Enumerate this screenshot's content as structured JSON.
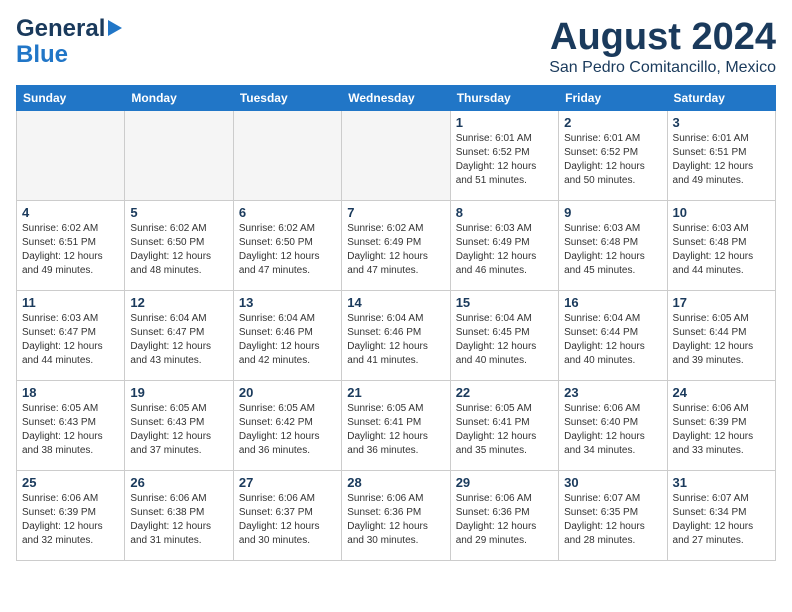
{
  "header": {
    "logo_line1": "General",
    "logo_line2": "Blue",
    "month": "August 2024",
    "location": "San Pedro Comitancillo, Mexico"
  },
  "days_of_week": [
    "Sunday",
    "Monday",
    "Tuesday",
    "Wednesday",
    "Thursday",
    "Friday",
    "Saturday"
  ],
  "weeks": [
    [
      {
        "day": "",
        "info": ""
      },
      {
        "day": "",
        "info": ""
      },
      {
        "day": "",
        "info": ""
      },
      {
        "day": "",
        "info": ""
      },
      {
        "day": "1",
        "info": "Sunrise: 6:01 AM\nSunset: 6:52 PM\nDaylight: 12 hours\nand 51 minutes."
      },
      {
        "day": "2",
        "info": "Sunrise: 6:01 AM\nSunset: 6:52 PM\nDaylight: 12 hours\nand 50 minutes."
      },
      {
        "day": "3",
        "info": "Sunrise: 6:01 AM\nSunset: 6:51 PM\nDaylight: 12 hours\nand 49 minutes."
      }
    ],
    [
      {
        "day": "4",
        "info": "Sunrise: 6:02 AM\nSunset: 6:51 PM\nDaylight: 12 hours\nand 49 minutes."
      },
      {
        "day": "5",
        "info": "Sunrise: 6:02 AM\nSunset: 6:50 PM\nDaylight: 12 hours\nand 48 minutes."
      },
      {
        "day": "6",
        "info": "Sunrise: 6:02 AM\nSunset: 6:50 PM\nDaylight: 12 hours\nand 47 minutes."
      },
      {
        "day": "7",
        "info": "Sunrise: 6:02 AM\nSunset: 6:49 PM\nDaylight: 12 hours\nand 47 minutes."
      },
      {
        "day": "8",
        "info": "Sunrise: 6:03 AM\nSunset: 6:49 PM\nDaylight: 12 hours\nand 46 minutes."
      },
      {
        "day": "9",
        "info": "Sunrise: 6:03 AM\nSunset: 6:48 PM\nDaylight: 12 hours\nand 45 minutes."
      },
      {
        "day": "10",
        "info": "Sunrise: 6:03 AM\nSunset: 6:48 PM\nDaylight: 12 hours\nand 44 minutes."
      }
    ],
    [
      {
        "day": "11",
        "info": "Sunrise: 6:03 AM\nSunset: 6:47 PM\nDaylight: 12 hours\nand 44 minutes."
      },
      {
        "day": "12",
        "info": "Sunrise: 6:04 AM\nSunset: 6:47 PM\nDaylight: 12 hours\nand 43 minutes."
      },
      {
        "day": "13",
        "info": "Sunrise: 6:04 AM\nSunset: 6:46 PM\nDaylight: 12 hours\nand 42 minutes."
      },
      {
        "day": "14",
        "info": "Sunrise: 6:04 AM\nSunset: 6:46 PM\nDaylight: 12 hours\nand 41 minutes."
      },
      {
        "day": "15",
        "info": "Sunrise: 6:04 AM\nSunset: 6:45 PM\nDaylight: 12 hours\nand 40 minutes."
      },
      {
        "day": "16",
        "info": "Sunrise: 6:04 AM\nSunset: 6:44 PM\nDaylight: 12 hours\nand 40 minutes."
      },
      {
        "day": "17",
        "info": "Sunrise: 6:05 AM\nSunset: 6:44 PM\nDaylight: 12 hours\nand 39 minutes."
      }
    ],
    [
      {
        "day": "18",
        "info": "Sunrise: 6:05 AM\nSunset: 6:43 PM\nDaylight: 12 hours\nand 38 minutes."
      },
      {
        "day": "19",
        "info": "Sunrise: 6:05 AM\nSunset: 6:43 PM\nDaylight: 12 hours\nand 37 minutes."
      },
      {
        "day": "20",
        "info": "Sunrise: 6:05 AM\nSunset: 6:42 PM\nDaylight: 12 hours\nand 36 minutes."
      },
      {
        "day": "21",
        "info": "Sunrise: 6:05 AM\nSunset: 6:41 PM\nDaylight: 12 hours\nand 36 minutes."
      },
      {
        "day": "22",
        "info": "Sunrise: 6:05 AM\nSunset: 6:41 PM\nDaylight: 12 hours\nand 35 minutes."
      },
      {
        "day": "23",
        "info": "Sunrise: 6:06 AM\nSunset: 6:40 PM\nDaylight: 12 hours\nand 34 minutes."
      },
      {
        "day": "24",
        "info": "Sunrise: 6:06 AM\nSunset: 6:39 PM\nDaylight: 12 hours\nand 33 minutes."
      }
    ],
    [
      {
        "day": "25",
        "info": "Sunrise: 6:06 AM\nSunset: 6:39 PM\nDaylight: 12 hours\nand 32 minutes."
      },
      {
        "day": "26",
        "info": "Sunrise: 6:06 AM\nSunset: 6:38 PM\nDaylight: 12 hours\nand 31 minutes."
      },
      {
        "day": "27",
        "info": "Sunrise: 6:06 AM\nSunset: 6:37 PM\nDaylight: 12 hours\nand 30 minutes."
      },
      {
        "day": "28",
        "info": "Sunrise: 6:06 AM\nSunset: 6:36 PM\nDaylight: 12 hours\nand 30 minutes."
      },
      {
        "day": "29",
        "info": "Sunrise: 6:06 AM\nSunset: 6:36 PM\nDaylight: 12 hours\nand 29 minutes."
      },
      {
        "day": "30",
        "info": "Sunrise: 6:07 AM\nSunset: 6:35 PM\nDaylight: 12 hours\nand 28 minutes."
      },
      {
        "day": "31",
        "info": "Sunrise: 6:07 AM\nSunset: 6:34 PM\nDaylight: 12 hours\nand 27 minutes."
      }
    ]
  ]
}
